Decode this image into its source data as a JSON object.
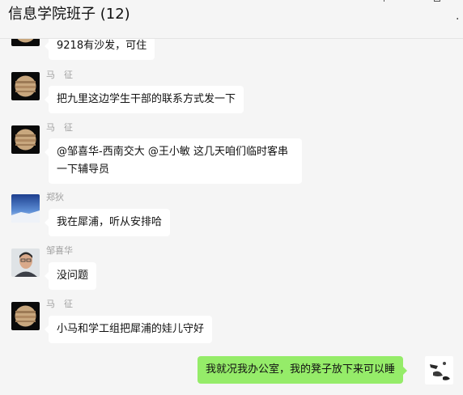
{
  "header": {
    "title": "信息学院班子 (12)",
    "more_label": "."
  },
  "messages": [
    {
      "sender": "",
      "avatar": "jupiter-icon",
      "text": "9218有沙发，可住"
    },
    {
      "sender": "马　征",
      "avatar": "jupiter-icon",
      "text": "把九里这边学生干部的联系方式发一下"
    },
    {
      "sender": "马　征",
      "avatar": "jupiter-icon",
      "text": "@邹喜华-西南交大 @王小敏 这几天咱们临时客串一下辅导员"
    },
    {
      "sender": "郑狄",
      "avatar": "sky-landscape-icon",
      "text": "我在犀浦，听从安排哈"
    },
    {
      "sender": "邹喜华",
      "avatar": "person-photo-icon",
      "text": "没问题"
    },
    {
      "sender": "马　征",
      "avatar": "jupiter-icon",
      "text": "小马和学工组把犀浦的娃儿守好"
    },
    {
      "sender": "",
      "avatar": "ink-drawing-icon",
      "text": "我就况我办公室，我的凳子放下来可以睡",
      "mine": true
    }
  ],
  "colors": {
    "background": "#f5f5f5",
    "bubble_other": "#ffffff",
    "bubble_mine": "#95ec69",
    "sender_name": "#a0a0a0"
  }
}
